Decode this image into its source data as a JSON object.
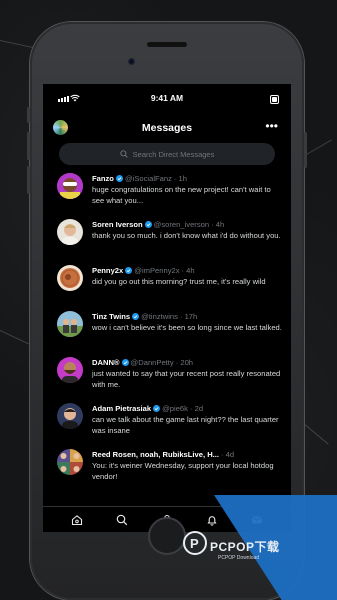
{
  "status_bar": {
    "time": "9:41 AM"
  },
  "header": {
    "title": "Messages",
    "more_label": "•••"
  },
  "search": {
    "placeholder": "Search Direct Messages"
  },
  "conversations": [
    {
      "name": "Fanzo",
      "handle": "@iSocialFanz",
      "time": "· 1h",
      "preview": "huge congratulations on the new project! can't wait to see what you..."
    },
    {
      "name": "Soren Iverson",
      "handle": "@soren_iverson",
      "time": "· 4h",
      "preview": "thank you so much. i don't know what i'd do without you."
    },
    {
      "name": "Penny2x",
      "handle": "@imPenny2x",
      "time": "· 4h",
      "preview": "did you go out this morning? trust me, it's really wild"
    },
    {
      "name": "Tinz Twins",
      "handle": "@tinztwins",
      "time": "· 17h",
      "preview": "wow i can't believe it's been so long since we last talked."
    },
    {
      "name": "DANN®",
      "handle": "@DannPetty",
      "time": "· 20h",
      "preview": "just wanted to say that your recent post really resonated with me."
    },
    {
      "name": "Adam Pietrasiak",
      "handle": "@pie6k",
      "time": "· 2d",
      "preview": "can we talk about the game last night?? the last quarter was insane"
    },
    {
      "name": "Reed Rosen, noah, RubiksLive, H...",
      "handle": "",
      "time": "· 4d",
      "preview": "You: it's weiner Wednesday, support your local hotdog vendor!"
    }
  ],
  "tabbar": {
    "items": [
      "home-icon",
      "search-icon",
      "spaces-icon",
      "notifications-icon",
      "messages-icon"
    ]
  },
  "watermark": {
    "text": "PCPOP下载",
    "sub": "PCPOP Download"
  },
  "colors": {
    "verified": "#1d9bf0",
    "background": "#000000",
    "watermark_blue": "#1c6fc2"
  }
}
